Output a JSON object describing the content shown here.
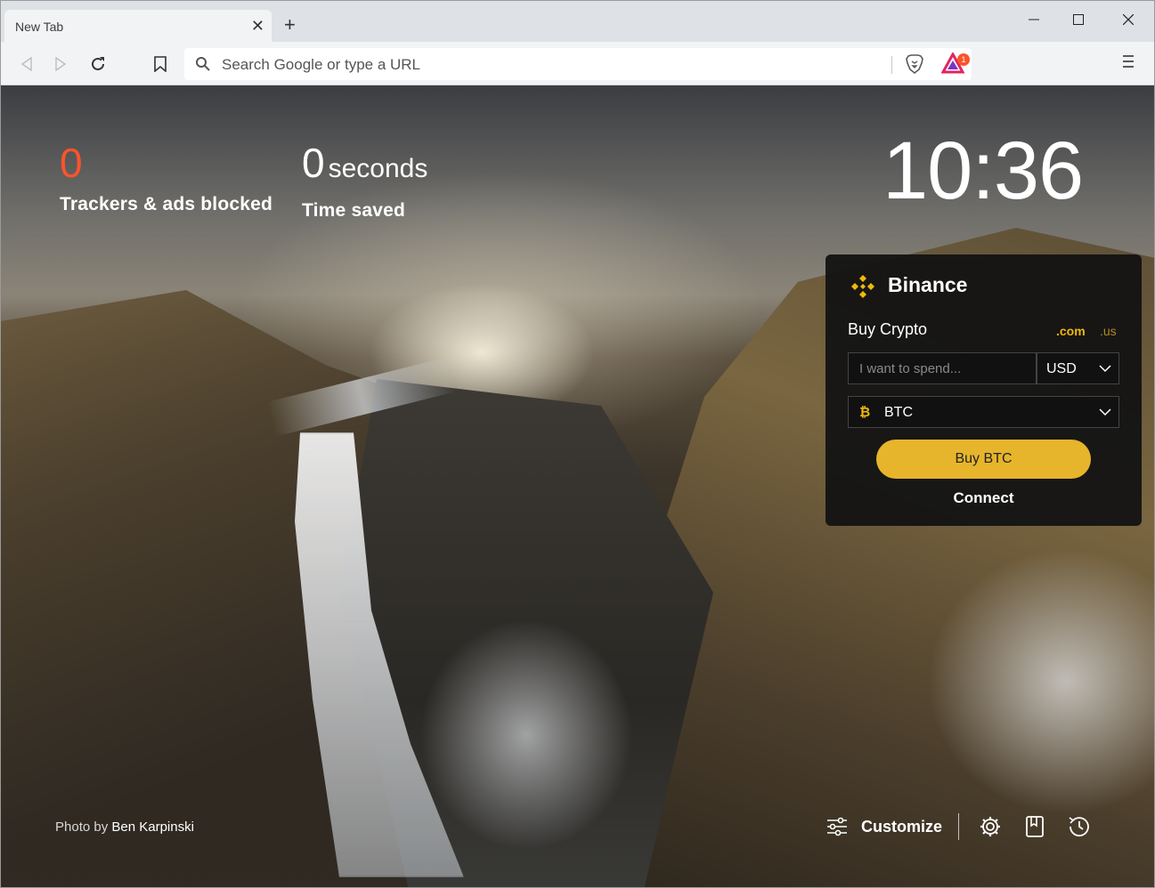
{
  "window": {
    "tab_title": "New Tab",
    "new_tab_symbol": "+",
    "close_symbol": "✕"
  },
  "toolbar": {
    "address_placeholder": "Search Google or type a URL",
    "rewards_badge_count": "1"
  },
  "stats": {
    "trackers_count": "0",
    "trackers_label": "Trackers & ads blocked",
    "time_value": "0",
    "time_unit": "seconds",
    "time_label": "Time saved"
  },
  "clock": "10:36",
  "binance": {
    "title": "Binance",
    "subtitle": "Buy Crypto",
    "domain_com": ".com",
    "domain_us": ".us",
    "spend_placeholder": "I want to spend...",
    "currency": "USD",
    "asset": "BTC",
    "buy_label": "Buy BTC",
    "connect_label": "Connect"
  },
  "footer": {
    "photo_prefix": "Photo by",
    "photo_author": "Ben Karpinski",
    "customize_label": "Customize"
  },
  "colors": {
    "accent_orange": "#fb542b",
    "binance_gold": "#f0b90b",
    "buy_button": "#e7b52b"
  }
}
